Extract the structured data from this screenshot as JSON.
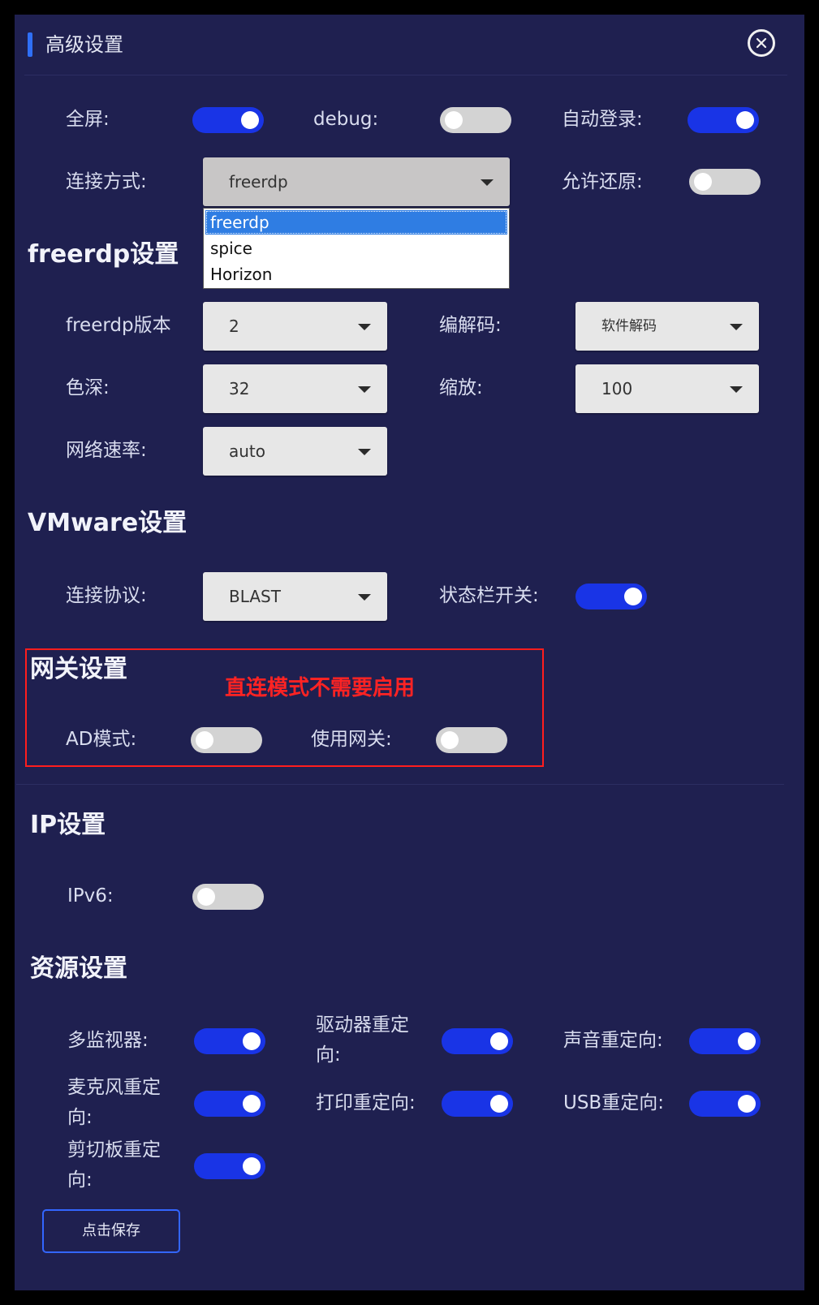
{
  "dialog": {
    "title": "高级设置"
  },
  "general": {
    "fullscreen_label": "全屏:",
    "fullscreen_on": true,
    "debug_label": "debug:",
    "debug_on": false,
    "autologin_label": "自动登录:",
    "autologin_on": true,
    "connection_label": "连接方式:",
    "connection_value": "freerdp",
    "connection_options": [
      "freerdp",
      "spice",
      "Horizon"
    ],
    "restore_label": "允许还原:",
    "restore_on": false
  },
  "freerdp": {
    "title": "freerdp设置",
    "version_label": "freerdp版本",
    "version_value": "2",
    "codec_label": "编解码:",
    "codec_value": "软件解码",
    "depth_label": "色深:",
    "depth_value": "32",
    "scale_label": "缩放:",
    "scale_value": "100",
    "network_label": "网络速率:",
    "network_value": "auto"
  },
  "vmware": {
    "title": "VMware设置",
    "protocol_label": "连接协议:",
    "protocol_value": "BLAST",
    "statusbar_label": "状态栏开关:",
    "statusbar_on": true
  },
  "gateway": {
    "title": "网关设置",
    "annotation": "直连模式不需要启用",
    "ad_label": "AD模式:",
    "ad_on": false,
    "use_label": "使用网关:",
    "use_on": false
  },
  "ip": {
    "title": "IP设置",
    "ipv6_label": "IPv6:",
    "ipv6_on": false
  },
  "resources": {
    "title": "资源设置",
    "monitor_label": "多监视器:",
    "monitor_on": true,
    "drive_label_1": "驱动器重定",
    "drive_label_2": "向:",
    "drive_on": true,
    "sound_label": "声音重定向:",
    "sound_on": true,
    "mic_label_1": "麦克风重定",
    "mic_label_2": "向:",
    "mic_on": true,
    "print_label": "打印重定向:",
    "print_on": true,
    "usb_label": "USB重定向:",
    "usb_on": true,
    "clipboard_label_1": "剪切板重定",
    "clipboard_label_2": "向:",
    "clipboard_on": true
  },
  "save_label": "点击保存",
  "colors": {
    "panel": "#1f2050",
    "toggle_on": "#1934e6",
    "toggle_off": "#d3d3d3",
    "accent": "#2f6ff7",
    "annotation": "#ff2323"
  }
}
